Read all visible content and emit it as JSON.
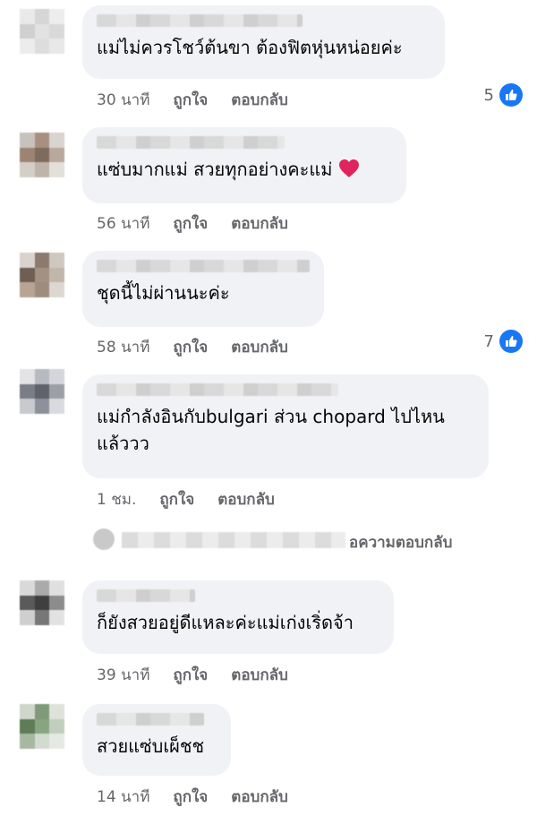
{
  "actions": {
    "like": "ถูกใจ",
    "reply": "ตอบกลับ"
  },
  "colors": {
    "bubble": "#f0f2f5",
    "meta": "#65676b",
    "like_blue": "#1877f2",
    "heart_red": "#e0245e"
  },
  "comments": [
    {
      "text": "แม่ไม่ควรโชว์ต้นขา ต้องฟิตหุ่นหน่อยค่ะ",
      "time": "30 นาที",
      "likes": "5"
    },
    {
      "text": "แซ่บมากแม่ สวยทุกอย่างคะแม่",
      "emoji": "heart-icon",
      "time": "56 นาที",
      "likes": ""
    },
    {
      "text": "ชุดนี้ไม่ผ่านนะค่ะ",
      "time": "58 นาที",
      "likes": "7"
    },
    {
      "text": "แม่กำลังอินกับbulgari ส่วน chopard ไปไหน\nแล้ววว",
      "time": "1 ชม.",
      "likes": ""
    },
    {
      "text": "ก็ยังสวยอยู่ดีแหละค่ะแม่เก่งเริ่ดจ้า",
      "time": "39 นาที",
      "likes": ""
    },
    {
      "text": "สวยแซ่บเผ็ชช",
      "time": "14 นาที",
      "likes": ""
    }
  ],
  "reply_preview": {
    "text": "อความตอบกลับ"
  }
}
